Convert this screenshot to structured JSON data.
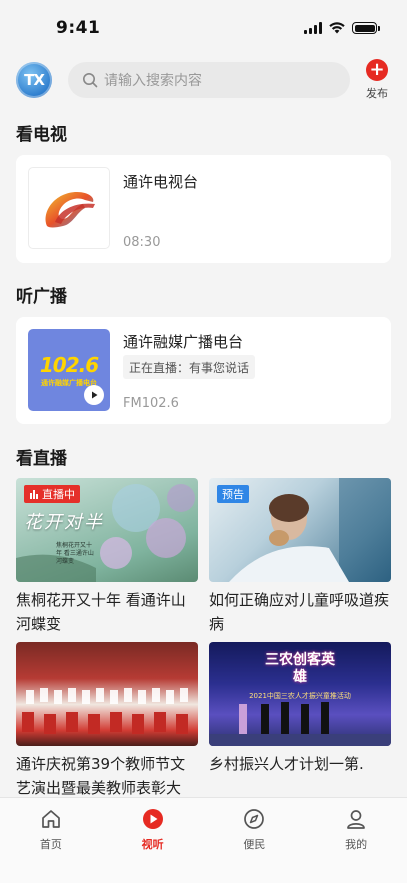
{
  "status_bar": {
    "time": "9:41"
  },
  "header": {
    "avatar_text": "TX",
    "search_placeholder": "请输入搜索内容",
    "publish_label": "发布"
  },
  "sections": {
    "tv": {
      "title": "看电视",
      "channel_name": "通许电视台",
      "time": "08:30"
    },
    "radio": {
      "title": "听广播",
      "station_name": "通许融媒广播电台",
      "now_playing": "正在直播：有事您说话",
      "frequency": "FM102.6",
      "logo_freq": "102.6",
      "logo_text": "通许融媒广播电台"
    },
    "live": {
      "title": "看直播",
      "items": [
        {
          "title": "焦桐花开又十年 看通许山河蝶变",
          "badge": "直播中",
          "badge_type": "live",
          "overlay_text": "花开对半",
          "overlay_sub": "焦桐花开又十年 看三通许山河蝶变"
        },
        {
          "title": "如何正确应对儿童呼吸道疾病",
          "badge": "预告",
          "badge_type": "preview"
        },
        {
          "title": "通许庆祝第39个教师节文艺演出暨最美教师表彰大",
          "badge": "",
          "badge_type": ""
        },
        {
          "title": "乡村振兴人才计划一第.",
          "badge": "",
          "badge_type": "",
          "overlay_text": "三农创客英雄",
          "overlay_sub": "2021中国三农人才振兴童推活动"
        }
      ]
    }
  },
  "tabbar": {
    "items": [
      {
        "label": "首页",
        "icon": "home-icon",
        "active": false
      },
      {
        "label": "视听",
        "icon": "play-icon",
        "active": true
      },
      {
        "label": "便民",
        "icon": "compass-icon",
        "active": false
      },
      {
        "label": "我的",
        "icon": "user-icon",
        "active": false
      }
    ]
  },
  "colors": {
    "accent": "#e62a22",
    "preview_badge": "#2f86e6",
    "radio_logo_bg": "#6f86df"
  }
}
